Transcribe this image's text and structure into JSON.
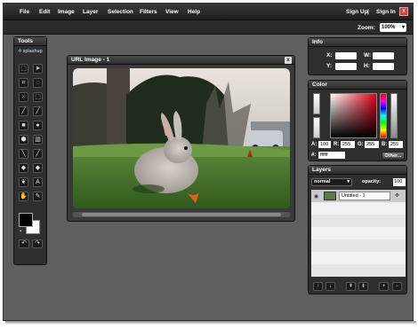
{
  "menubar": {
    "menus": [
      "File",
      "Edit",
      "Image",
      "Layer",
      "Selection",
      "Filters",
      "View",
      "Help"
    ],
    "auth": {
      "sign_up": "Sign Up",
      "separator": "|",
      "sign_in": "Sign In"
    },
    "close_glyph": "x"
  },
  "zoom": {
    "label": "Zoom:",
    "value": "100%"
  },
  "tools": {
    "title": "Tools",
    "logo": "splashup",
    "buttons": [
      {
        "name": "marquee-icon",
        "glyph": "⬚"
      },
      {
        "name": "move-icon",
        "glyph": "➤"
      },
      {
        "name": "crop-icon",
        "glyph": "⌗"
      },
      {
        "name": "lasso-icon",
        "glyph": "◌"
      },
      {
        "name": "magic-wand-icon",
        "glyph": "⁙"
      },
      {
        "name": "transform-icon",
        "glyph": "⬚"
      },
      {
        "name": "pencil-icon",
        "glyph": "╱"
      },
      {
        "name": "brush-icon",
        "glyph": "╱"
      },
      {
        "name": "rectangle-icon",
        "glyph": "■"
      },
      {
        "name": "ellipse-icon",
        "glyph": "●"
      },
      {
        "name": "polygon-icon",
        "glyph": "⬢"
      },
      {
        "name": "gradient-icon",
        "glyph": "▥"
      },
      {
        "name": "eraser-icon",
        "glyph": "╲"
      },
      {
        "name": "clone-icon",
        "glyph": "╱"
      },
      {
        "name": "smudge-icon",
        "glyph": "◆"
      },
      {
        "name": "blur-icon",
        "glyph": "◆"
      },
      {
        "name": "dodge-icon",
        "glyph": "❦"
      },
      {
        "name": "text-icon",
        "glyph": "A"
      },
      {
        "name": "hand-icon",
        "glyph": "✋"
      },
      {
        "name": "eyedropper-icon",
        "glyph": "✎"
      }
    ],
    "undo_glyph": "↶",
    "redo_glyph": "↷",
    "swap_glyph": "▪"
  },
  "image_window": {
    "title": "URL Image - 1",
    "close_glyph": "x"
  },
  "info": {
    "title": "Info",
    "x_label": "X:",
    "y_label": "Y:",
    "w_label": "W:",
    "h_label": "H:"
  },
  "color": {
    "title": "Color",
    "a_label": "A:",
    "a_value": "100",
    "r_label": "R:",
    "r_value": "255",
    "g_label": "G:",
    "g_value": "255",
    "b_label": "B:",
    "b_value": "255",
    "hash_label": "#:",
    "hex_value": "ffffff",
    "other_label": "Other..."
  },
  "layers": {
    "title": "Layers",
    "blend_mode": "normal",
    "opacity_label": "opacity:",
    "opacity_value": "100",
    "items": [
      {
        "name": "Untitled - 1"
      }
    ],
    "buttons": [
      {
        "name": "move-layer-up-icon",
        "glyph": "↑"
      },
      {
        "name": "move-layer-down-icon",
        "glyph": "↓"
      },
      {
        "name": "merge-up-icon",
        "glyph": "⇞"
      },
      {
        "name": "merge-down-icon",
        "glyph": "⇟"
      },
      {
        "name": "add-layer-icon",
        "glyph": "+"
      },
      {
        "name": "delete-layer-icon",
        "glyph": "−"
      }
    ]
  },
  "colors": {
    "accent_red": "#e2001a",
    "panel_bg": "#2f2f2f",
    "workspace": "#5f5f5f"
  }
}
